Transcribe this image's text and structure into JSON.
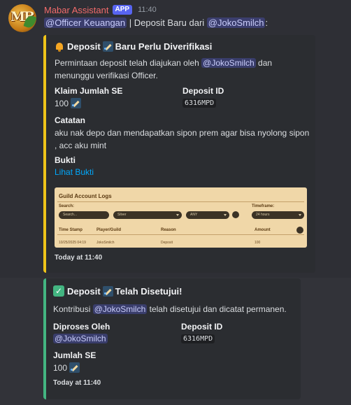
{
  "message": {
    "username": "Mabar Assistant",
    "badge": "APP",
    "timestamp": "11:40",
    "avatar_text": "MB",
    "mention_role": "@Officer Keuangan",
    "content_middle": " | Deposit Baru dari ",
    "mention_user": "@JokoSmilch",
    "content_end": ":"
  },
  "embed1": {
    "accent": "#f0c419",
    "title_pre": "Deposit",
    "title_post": "Baru Perlu Diverifikasi",
    "desc_pre": "Permintaan deposit telah diajukan oleh",
    "desc_mention": "@JokoSmilch",
    "desc_post": "dan",
    "desc_line2": "menunggu verifikasi Officer.",
    "field1_name": "Klaim Jumlah SE",
    "field1_value": "100",
    "field2_name": "Deposit ID",
    "field2_value": "6316MPD",
    "field3_name": "Catatan",
    "field3_line1": "aku nak depo dan mendapatkan sipon prem agar bisa nyolong sipon",
    "field3_line2": ", acc aku mint",
    "field4_name": "Bukti",
    "field4_link": "Lihat Bukti",
    "footer": "Today at 11:40",
    "image": {
      "title": "Guild Account Logs",
      "search_label": "Search:",
      "timeframe_label": "Timeframe:",
      "search_placeholder": "Search...",
      "select1": "Silver",
      "select2": "ANY",
      "timeframe_value": "24 hours",
      "col_time": "Time Stamp",
      "col_player": "Player/Guild",
      "col_reason": "Reason",
      "col_amount": "Amount",
      "row_time": "10/25/2025 04:19",
      "row_player": "JokoSmilch",
      "row_reason": "Deposit",
      "row_amount": "100"
    }
  },
  "embed2": {
    "accent": "#43b581",
    "title_pre": "Deposit",
    "title_post": "Telah Disetujui!",
    "desc_pre": "Kontribusi",
    "desc_mention": "@JokoSmilch",
    "desc_post": "telah disetujui dan dicatat permanen.",
    "field1_name": "Diproses Oleh",
    "field1_value": "@JokoSmilch",
    "field2_name": "Deposit ID",
    "field2_value": "6316MPD",
    "field3_name": "Jumlah SE",
    "field3_value": "100",
    "footer": "Today at 11:40"
  }
}
